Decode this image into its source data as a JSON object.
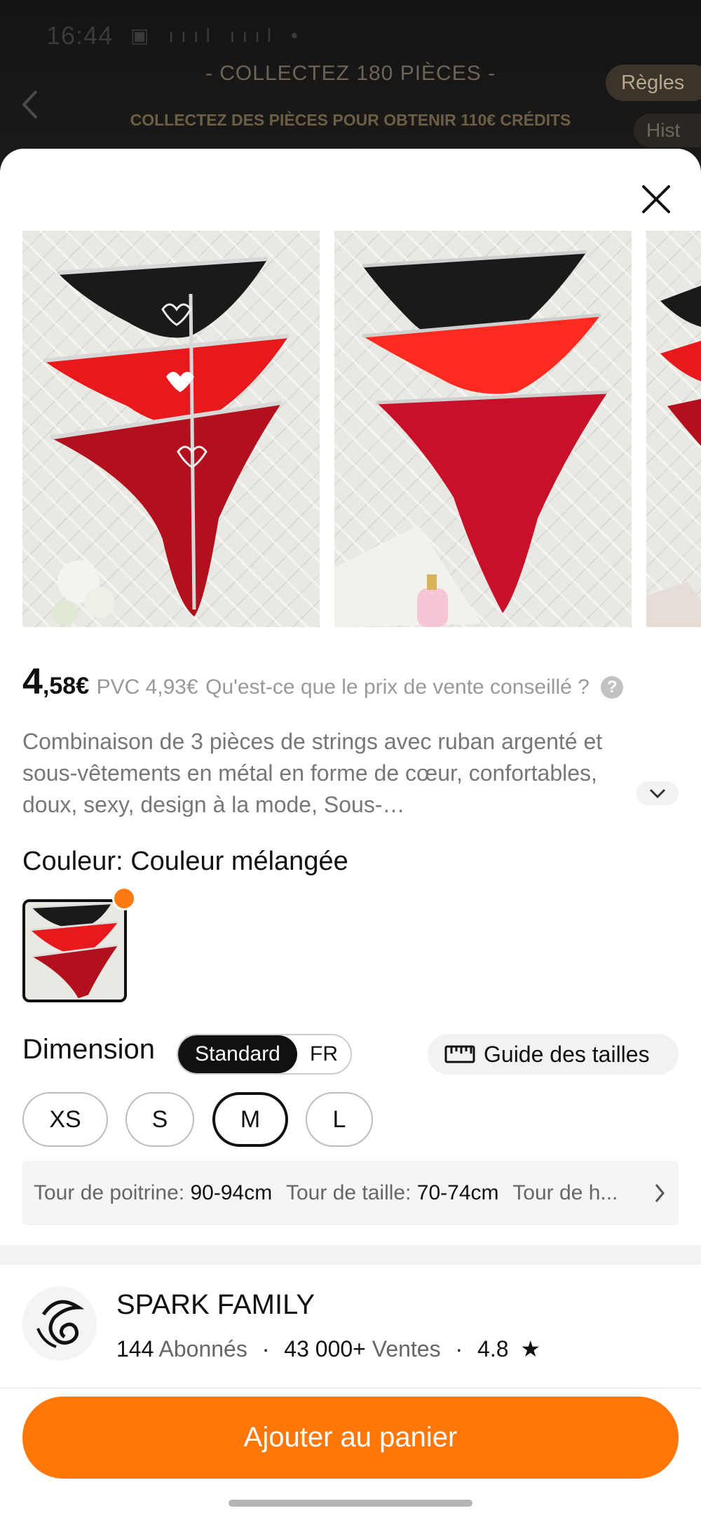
{
  "status_bar": {
    "time": "16:44",
    "icons": "▣ ıııl ıııl •"
  },
  "background": {
    "title": "- COLLECTEZ 180 PIÈCES -",
    "subtitle": "COLLECTEZ DES PIÈCES POUR OBTENIR 110€ CRÉDITS",
    "rules_label": "Règles",
    "history_label": "Hist"
  },
  "product": {
    "price_int": "4",
    "price_dec": ",58",
    "currency": "€",
    "pvc": "PVC 4,93€",
    "pvc_question": "Qu'est-ce que le prix de vente conseillé ?",
    "description": "Combinaison de 3 pièces de strings avec ruban argenté et sous-vêtements en métal en forme de cœur, confortables, doux, sexy, design à la mode, Sous-…",
    "color_label": "Couleur: Couleur mélangée",
    "dimension_label": "Dimension",
    "unit_standard": "Standard",
    "unit_fr": "FR",
    "size_guide": "Guide des tailles",
    "sizes": [
      "XS",
      "S",
      "M",
      "L"
    ],
    "selected_size": "M",
    "measurements": [
      {
        "label": "Tour de poitrine:",
        "value": "90-94cm"
      },
      {
        "label": "Tour de taille:",
        "value": "70-74cm"
      },
      {
        "label": "Tour de h...",
        "value": ""
      }
    ]
  },
  "store": {
    "name": "SPARK FAMILY",
    "followers": "144",
    "followers_label": "Abonnés",
    "sales": "43 000+",
    "sales_label": "Ventes",
    "rating": "4.8"
  },
  "cart_button": "Ajouter au panier",
  "colors": {
    "accent": "#fe7708",
    "black": "#1a1a1a",
    "red": "#e8191c",
    "dark_red": "#b3101e"
  }
}
